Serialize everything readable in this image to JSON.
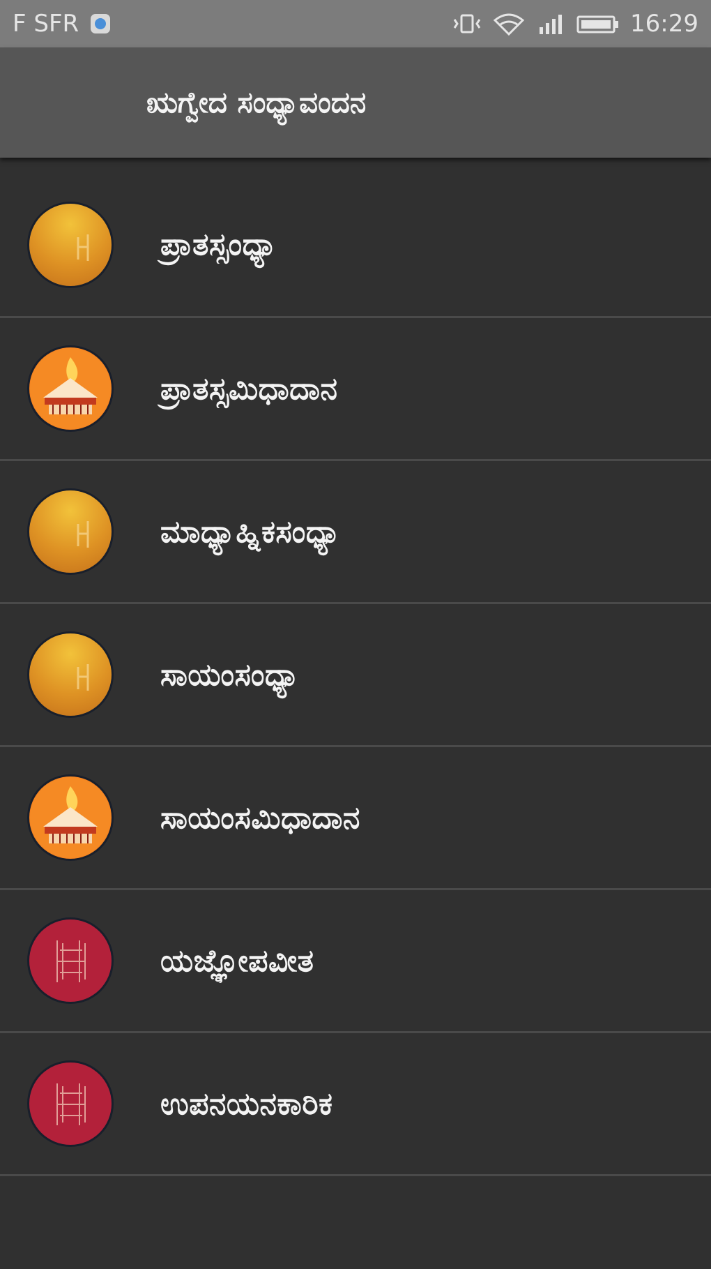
{
  "status_bar": {
    "carrier": "F SFR",
    "time": "16:29",
    "icons": [
      "carrier-app-icon",
      "vibrate-icon",
      "wifi-icon",
      "signal-icon",
      "battery-icon"
    ]
  },
  "app_bar": {
    "title": "ಋಗ್ವೇದ ಸಂಧ್ಯಾವಂದನ"
  },
  "menu": {
    "items": [
      {
        "label": "ಪ್ರಾತಸ್ಸಂಧ್ಯಾ",
        "icon": "sun-icon"
      },
      {
        "label": "ಪ್ರಾತಸ್ಸಮಿಧಾದಾನ",
        "icon": "fire-altar-icon"
      },
      {
        "label": "ಮಾಧ್ಯಾಹ್ನಿಕಸಂಧ್ಯಾ",
        "icon": "sun-icon"
      },
      {
        "label": "ಸಾಯಂಸಂಧ್ಯಾ",
        "icon": "sun-icon"
      },
      {
        "label": "ಸಾಯಂಸಮಿಧಾದಾನ",
        "icon": "fire-altar-icon"
      },
      {
        "label": "ಯಜ್ಞೋಪವೀತ",
        "icon": "sacred-thread-icon"
      },
      {
        "label": "ಉಪನಯನಕಾರಿಕ",
        "icon": "sacred-thread-icon"
      }
    ]
  },
  "colors": {
    "background": "#303030",
    "app_bar": "#565656",
    "status_bar": "#7c7c7c",
    "divider": "#4a4a4a",
    "sun_orange": "#d98b1c",
    "fire_orange": "#f07d1e",
    "thread_red": "#b3213a"
  }
}
